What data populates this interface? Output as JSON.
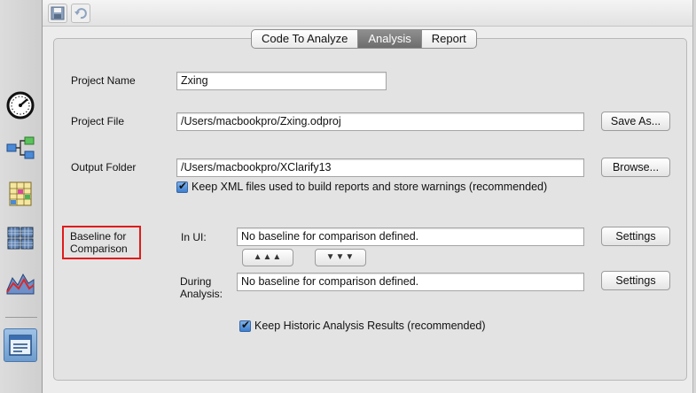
{
  "sidebar": {
    "items": [
      {
        "icon": "gauge-icon"
      },
      {
        "icon": "flow-diagram-icon"
      },
      {
        "icon": "grid-check-icon"
      },
      {
        "icon": "table-grid-icon"
      },
      {
        "icon": "mountain-chart-icon"
      },
      {
        "icon": "window-icon",
        "active": true
      }
    ]
  },
  "toolbar": {
    "save_icon": "save-icon",
    "undo_icon": "undo-icon"
  },
  "tabs": [
    "Code To Analyze",
    "Analysis",
    "Report"
  ],
  "selected_tab": "Analysis",
  "form": {
    "project_name_label": "Project Name",
    "project_name_value": "Zxing",
    "project_file_label": "Project File",
    "project_file_value": "/Users/macbookpro/Zxing.odproj",
    "save_as_label": "Save As...",
    "output_folder_label": "Output Folder",
    "output_folder_value": "/Users/macbookpro/XClarify13",
    "browse_label": "Browse...",
    "keep_xml_label": "Keep XML files used to build reports and store warnings (recommended)",
    "keep_xml_checked": true,
    "baseline_label_line1": "Baseline for",
    "baseline_label_line2": "Comparison",
    "in_ui_label": "In UI:",
    "in_ui_value": "No baseline for comparison defined.",
    "settings_label": "Settings",
    "up_arrows": "▲▲▲",
    "down_arrows": "▼▼▼",
    "during_label_line1": "During",
    "during_label_line2": "Analysis:",
    "during_value": "No baseline for comparison defined.",
    "keep_historic_label": "Keep Historic Analysis Results (recommended)",
    "keep_historic_checked": true
  },
  "colors": {
    "highlight": "#e01b1b",
    "selected_tab": "#7a7a7a",
    "checkbox": "#3d7fcf"
  }
}
